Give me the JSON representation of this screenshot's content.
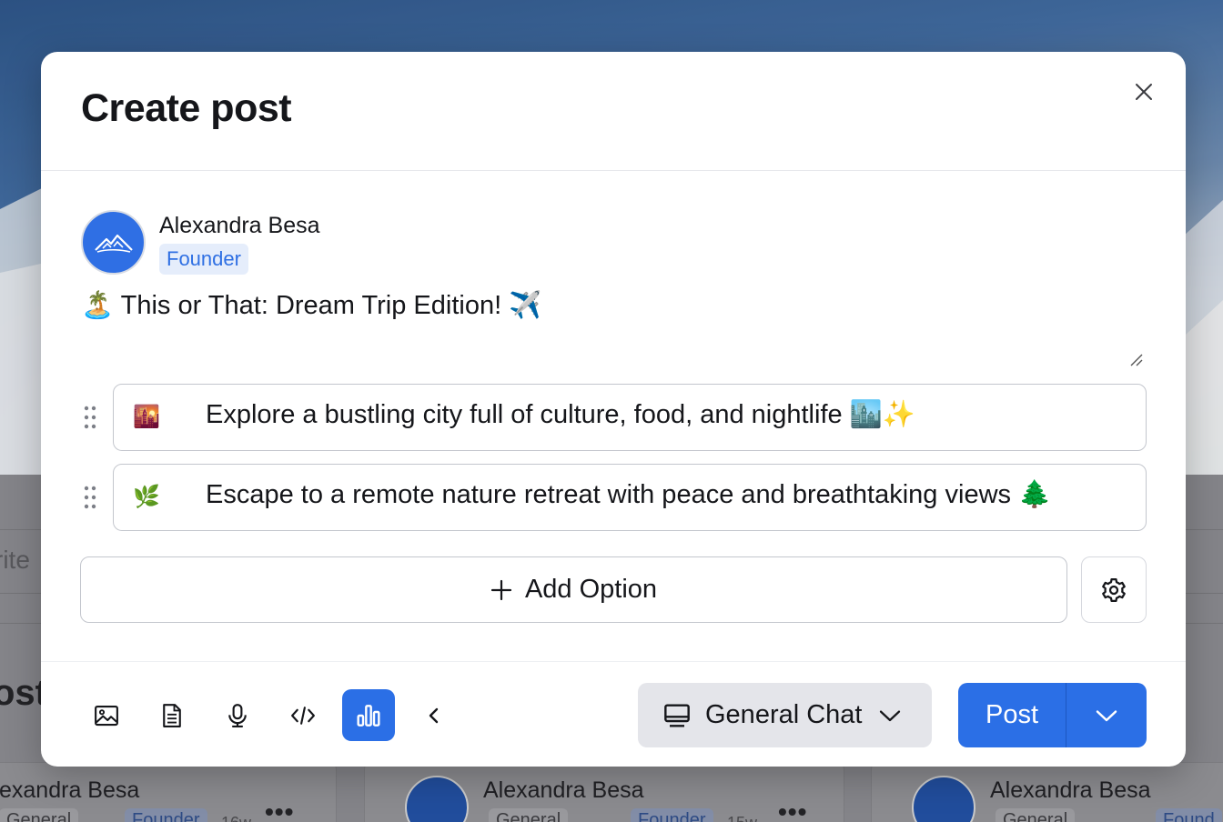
{
  "background": {
    "write_placeholder_fragment": "rite",
    "posts_heading_fragment": "ost",
    "cards": [
      {
        "name": "exandra Besa",
        "channel": "General",
        "role": "Founder",
        "age": "16w"
      },
      {
        "name": "Alexandra Besa",
        "channel": "General",
        "role": "Founder",
        "age": "15w"
      },
      {
        "name": "Alexandra Besa",
        "channel": "General",
        "role": "Found"
      }
    ],
    "more_glyph": "•••"
  },
  "modal": {
    "title": "Create post",
    "close_icon": "close-icon"
  },
  "author": {
    "name": "Alexandra Besa",
    "role": "Founder",
    "avatar_icon": "mountain-logo-icon"
  },
  "post": {
    "text": "🏝️ This or That: Dream Trip Edition! ✈️"
  },
  "poll": {
    "options": [
      {
        "emoji": "🌇",
        "text": "Explore a bustling city full of culture, food, and nightlife 🏙️✨"
      },
      {
        "emoji": "🌿",
        "text": "Escape to a remote nature retreat with peace and breathtaking views 🌲"
      }
    ],
    "add_option_label": "Add Option",
    "settings_icon": "gear-icon"
  },
  "toolbar": {
    "tools": [
      "image-icon",
      "document-icon",
      "microphone-icon",
      "code-icon",
      "poll-chart-icon",
      "chevron-left-icon"
    ],
    "active_tool": "poll-chart-icon"
  },
  "channel": {
    "selected": "General Chat",
    "icon": "monitor-icon"
  },
  "submit": {
    "label": "Post"
  },
  "colors": {
    "accent": "#2b6fe6",
    "badge_bg": "#e5edfb",
    "badge_text": "#2e6fe3",
    "select_bg": "#e4e5ea"
  }
}
